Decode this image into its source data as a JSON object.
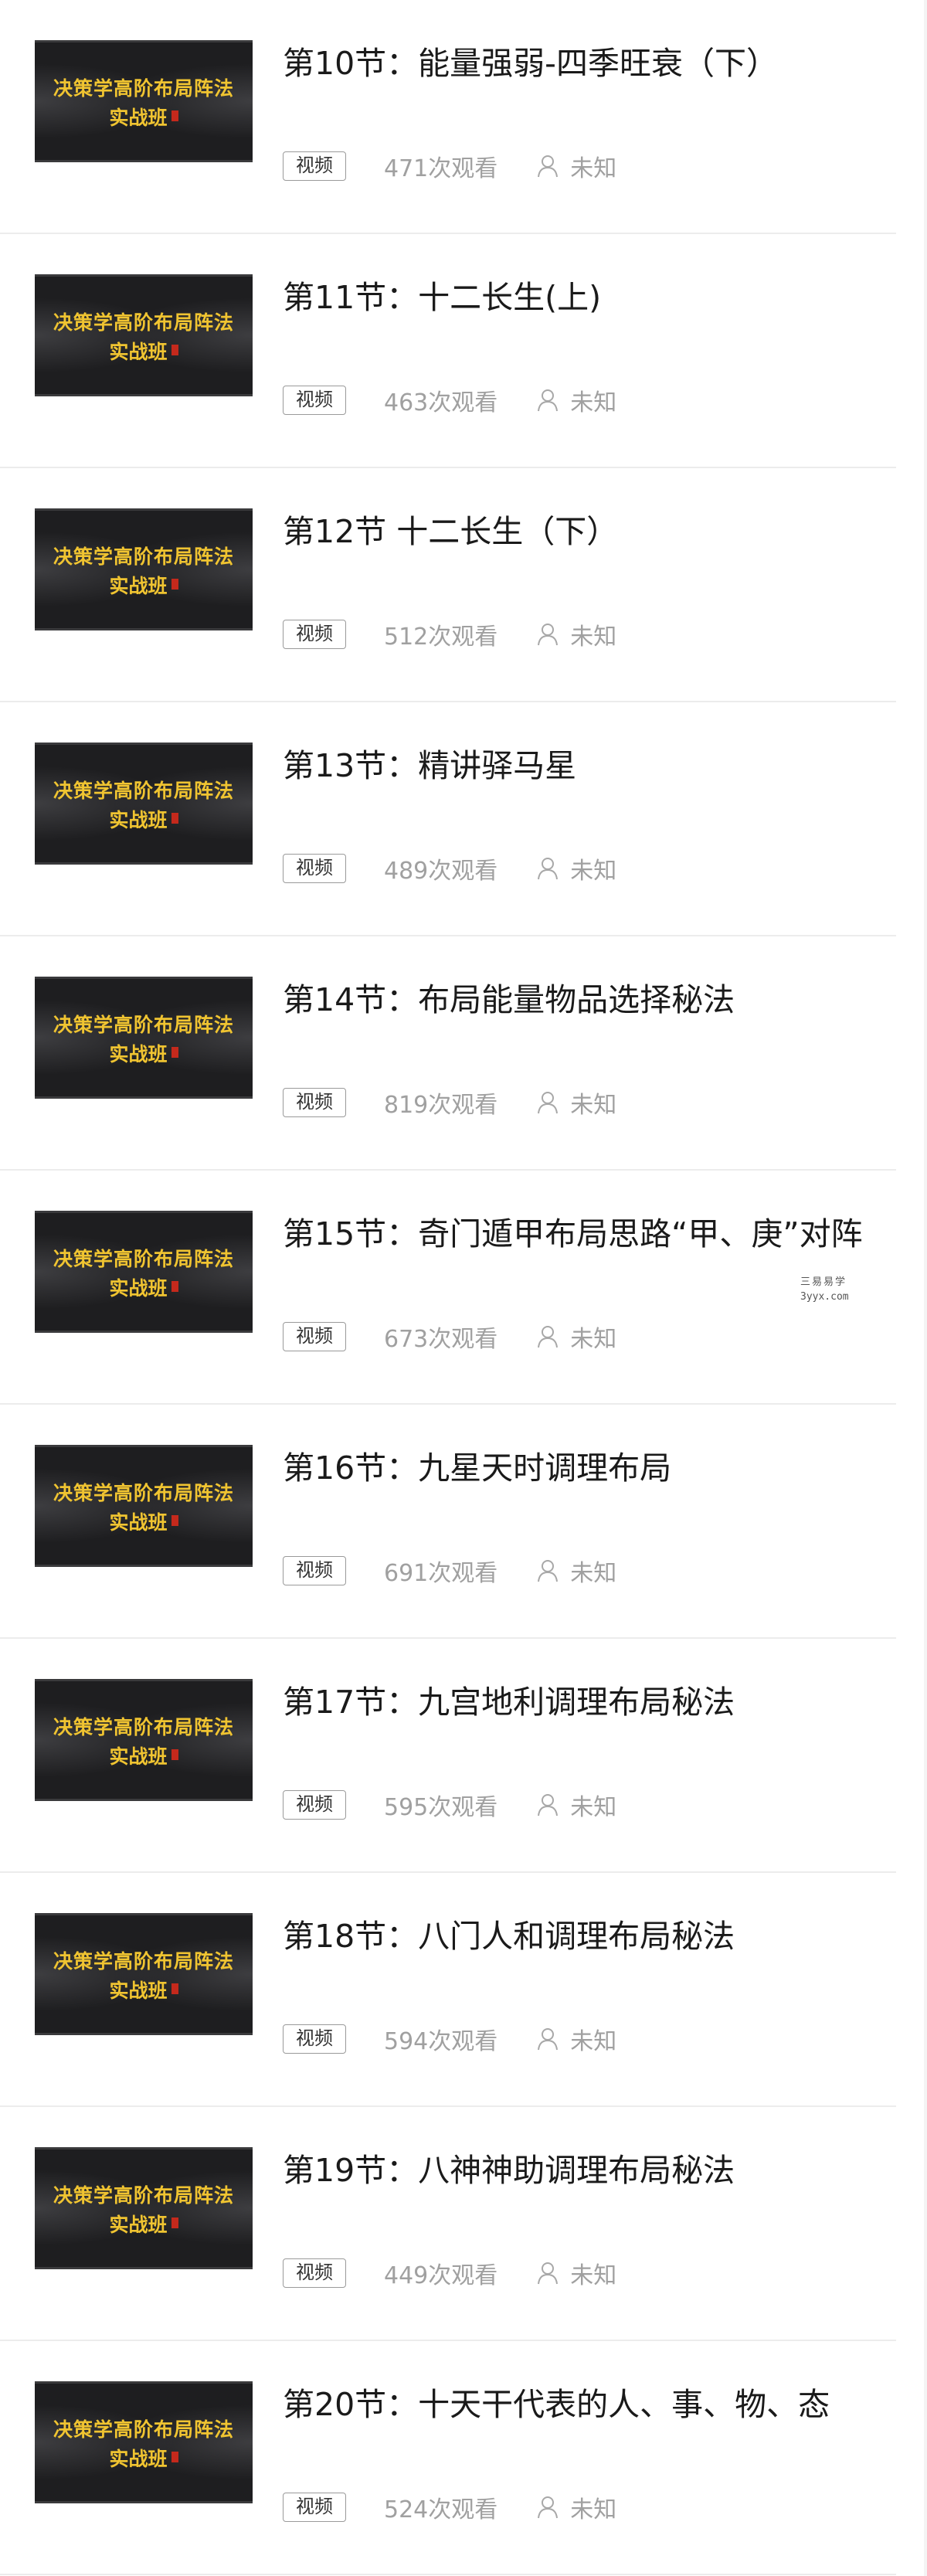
{
  "course": {
    "thumbnail_line1": "决策学高阶布局阵法",
    "thumbnail_line2": "实战班"
  },
  "watermark": {
    "text": "三易易学",
    "url": "3yyx.com"
  },
  "lessons": [
    {
      "title": "第10节：能量强弱-四季旺衰（下）",
      "tag": "视频",
      "views": "471次观看",
      "author": "未知"
    },
    {
      "title": "第11节：十二长生(上)",
      "tag": "视频",
      "views": "463次观看",
      "author": "未知"
    },
    {
      "title": "第12节 十二长生（下）",
      "tag": "视频",
      "views": "512次观看",
      "author": "未知"
    },
    {
      "title": "第13节：精讲驿马星",
      "tag": "视频",
      "views": "489次观看",
      "author": "未知"
    },
    {
      "title": "第14节：布局能量物品选择秘法",
      "tag": "视频",
      "views": "819次观看",
      "author": "未知"
    },
    {
      "title": "第15节：奇门遁甲布局思路“甲、庚”对阵",
      "tag": "视频",
      "views": "673次观看",
      "author": "未知"
    },
    {
      "title": "第16节：九星天时调理布局",
      "tag": "视频",
      "views": "691次观看",
      "author": "未知"
    },
    {
      "title": "第17节：九宫地利调理布局秘法",
      "tag": "视频",
      "views": "595次观看",
      "author": "未知"
    },
    {
      "title": "第18节：八门人和调理布局秘法",
      "tag": "视频",
      "views": "594次观看",
      "author": "未知"
    },
    {
      "title": "第19节：八神神助调理布局秘法",
      "tag": "视频",
      "views": "449次观看",
      "author": "未知"
    },
    {
      "title": "第20节：十天干代表的人、事、物、态",
      "tag": "视频",
      "views": "524次观看",
      "author": "未知"
    }
  ]
}
